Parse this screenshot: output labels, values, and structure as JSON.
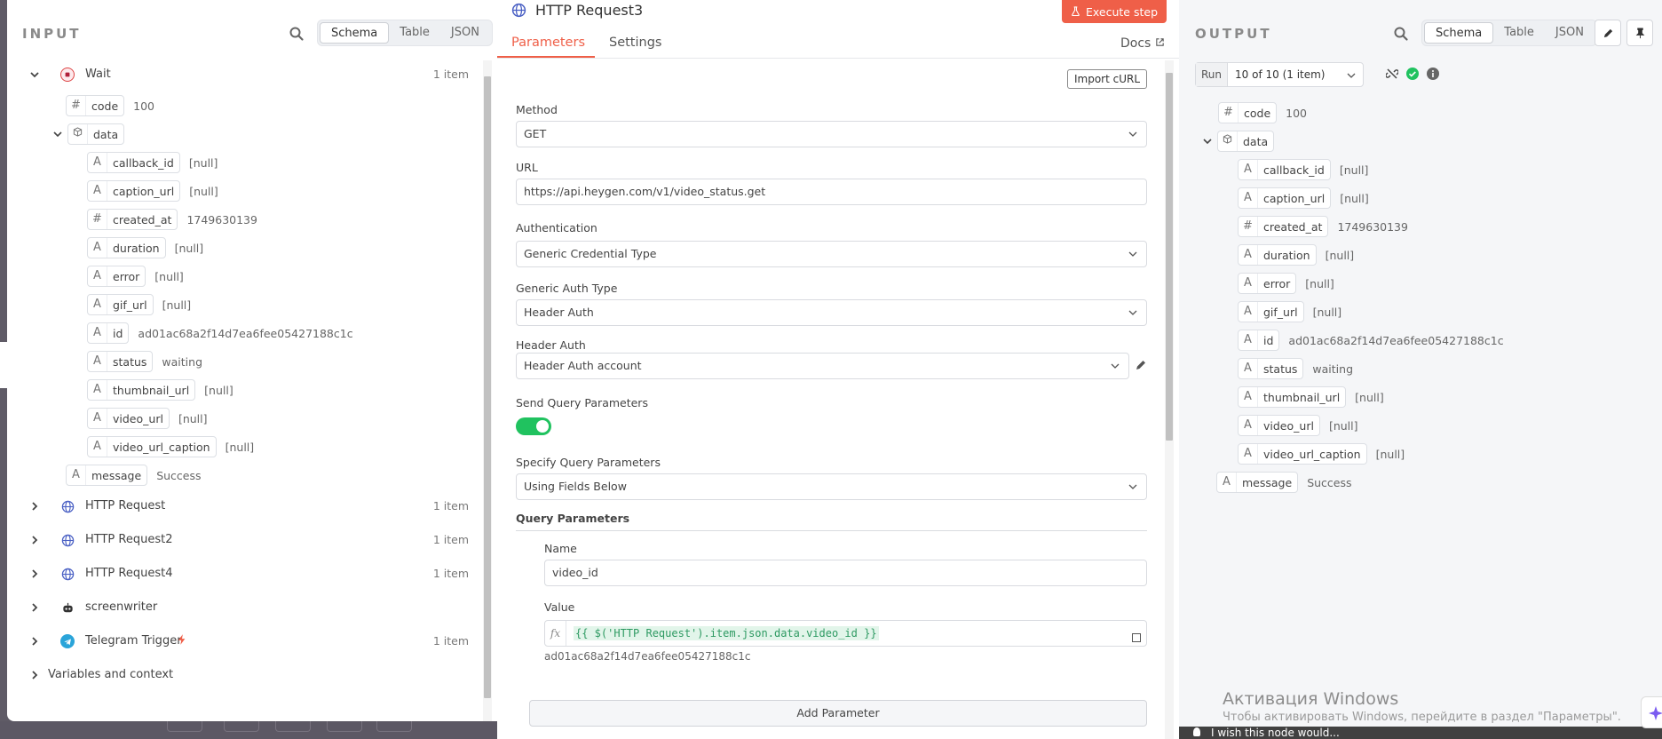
{
  "input": {
    "title": "INPUT",
    "view_options": [
      "Schema",
      "Table",
      "JSON"
    ],
    "active_view": "Schema",
    "nodes": [
      {
        "label": "Wait",
        "count": "1 item"
      },
      {
        "label": "HTTP Request",
        "count": "1 item"
      },
      {
        "label": "HTTP Request2",
        "count": "1 item"
      },
      {
        "label": "HTTP Request4",
        "count": "1 item"
      },
      {
        "label": "screenwriter",
        "count": ""
      },
      {
        "label": "Telegram Trigger",
        "count": "1 item"
      },
      {
        "label": "Variables and context",
        "count": ""
      }
    ],
    "fields": {
      "code": {
        "type": "#",
        "key": "code",
        "value": "100"
      },
      "data": {
        "type": "obj",
        "key": "data",
        "value": ""
      },
      "callback_id": {
        "type": "A",
        "key": "callback_id",
        "value": "[null]"
      },
      "caption_url": {
        "type": "A",
        "key": "caption_url",
        "value": "[null]"
      },
      "created_at": {
        "type": "#",
        "key": "created_at",
        "value": "1749630139"
      },
      "duration": {
        "type": "A",
        "key": "duration",
        "value": "[null]"
      },
      "error": {
        "type": "A",
        "key": "error",
        "value": "[null]"
      },
      "gif_url": {
        "type": "A",
        "key": "gif_url",
        "value": "[null]"
      },
      "id": {
        "type": "A",
        "key": "id",
        "value": "ad01ac68a2f14d7ea6fee05427188c1c"
      },
      "status": {
        "type": "A",
        "key": "status",
        "value": "waiting"
      },
      "thumbnail_url": {
        "type": "A",
        "key": "thumbnail_url",
        "value": "[null]"
      },
      "video_url": {
        "type": "A",
        "key": "video_url",
        "value": "[null]"
      },
      "video_url_caption": {
        "type": "A",
        "key": "video_url_caption",
        "value": "[null]"
      },
      "message": {
        "type": "A",
        "key": "message",
        "value": "Success"
      }
    }
  },
  "node": {
    "title": "HTTP Request3",
    "execute_label": "Execute step",
    "tabs": [
      "Parameters",
      "Settings"
    ],
    "docs_label": "Docs",
    "import_curl": "Import cURL",
    "method_label": "Method",
    "method_value": "GET",
    "url_label": "URL",
    "url_value": "https://api.heygen.com/v1/video_status.get",
    "auth_label": "Authentication",
    "auth_value": "Generic Credential Type",
    "generic_auth_label": "Generic Auth Type",
    "generic_auth_value": "Header Auth",
    "header_auth_label": "Header Auth",
    "header_auth_value": "Header Auth account",
    "send_query_label": "Send Query Parameters",
    "send_query_on": true,
    "specify_query_label": "Specify Query Parameters",
    "specify_query_value": "Using Fields Below",
    "query_params_label": "Query Parameters",
    "param_name_label": "Name",
    "param_name_value": "video_id",
    "param_value_label": "Value",
    "param_value_fx": "fx",
    "param_value_expr": "{{ $('HTTP Request').item.json.data.video_id }}",
    "param_value_result": "ad01ac68a2f14d7ea6fee05427188c1c",
    "add_param_label": "Add Parameter"
  },
  "output": {
    "title": "OUTPUT",
    "view_options": [
      "Schema",
      "Table",
      "JSON"
    ],
    "run_label": "Run",
    "run_value": "10 of 10 (1 item)"
  },
  "os": {
    "watermark_title": "Активация Windows",
    "watermark_sub": "Чтобы активировать Windows, перейдите в раздел \"Параметры\".",
    "feedback": "I wish this node would..."
  },
  "colors": {
    "accent": "#ef5f48",
    "toggle_on": "#20c25f",
    "success": "#20c25f",
    "expr_text": "#2e9a62"
  }
}
